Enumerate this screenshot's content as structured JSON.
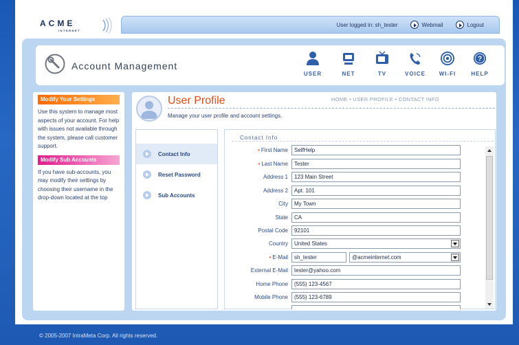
{
  "brand": {
    "name": "ACME",
    "sub": "INTERNET"
  },
  "topbar": {
    "user_text": "User logged in: sh_tester",
    "webmail": "Webmail",
    "logout": "Logout"
  },
  "header": {
    "title": "Account Management",
    "nav": [
      {
        "label": "USER",
        "icon": "user-icon"
      },
      {
        "label": "NET",
        "icon": "net-icon"
      },
      {
        "label": "TV",
        "icon": "tv-icon"
      },
      {
        "label": "VOICE",
        "icon": "phone-icon"
      },
      {
        "label": "WI-FI",
        "icon": "wifi-icon"
      },
      {
        "label": "HELP",
        "icon": "help-icon"
      }
    ]
  },
  "sidebar": {
    "settings_head": "Modify Your Settings",
    "settings_text": "Use this system to manage most aspects of your account.  For help with issues not available through the system, please call customer support.",
    "sub_head": "Modify Sub Accounts",
    "sub_text": "If you have sub-accounts, you may modify their settings by choosing their username in the drop-down located at the top",
    "colors": {
      "settings": "#ff6a00",
      "sub": "#e21b8c"
    }
  },
  "profile": {
    "title": "User Profile",
    "subtitle": "Manage your user profile and account settings.",
    "breadcrumb": "HOME • USER PROFILE • CONTACT INFO"
  },
  "tabs": [
    "Contact Info",
    "Reset Password",
    "Sub Accounts"
  ],
  "form": {
    "title": "Contact Info",
    "first_name": {
      "label": "First Name",
      "value": "SelfHelp"
    },
    "last_name": {
      "label": "Last Name",
      "value": "Tester"
    },
    "address1": {
      "label": "Address 1",
      "value": "123 Main Street"
    },
    "address2": {
      "label": "Address 2",
      "value": "Apt. 101"
    },
    "city": {
      "label": "City",
      "value": "My Town"
    },
    "state": {
      "label": "State",
      "value": "CA"
    },
    "postal": {
      "label": "Postal Code",
      "value": "92101"
    },
    "country": {
      "label": "Country",
      "value": "United States"
    },
    "email": {
      "label": "E-Mail",
      "user": "sh_tester",
      "domain": "@acmeinternet.com"
    },
    "ext_email": {
      "label": "External E-Mail",
      "value": "tester@yahoo.com"
    },
    "home_phone": {
      "label": "Home Phone",
      "value": "(555) 123-4567"
    },
    "mobile_phone": {
      "label": "Mobile Phone",
      "value": "(555) 123-6789"
    }
  },
  "footer": "© 2005-2007 IntraMeta Corp. All rights reserved."
}
